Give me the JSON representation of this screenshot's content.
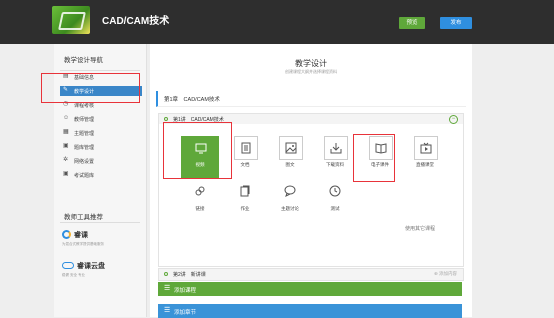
{
  "header": {
    "app_title": "CAD/CAM技术",
    "preview_label": "预览",
    "publish_label": "发布"
  },
  "sidebar": {
    "title": "教学设计导航",
    "items": [
      {
        "label": "基础信息",
        "icon": "document-icon"
      },
      {
        "label": "教学设计",
        "icon": "edit-icon",
        "active": true
      },
      {
        "label": "课程考核",
        "icon": "clock-icon"
      },
      {
        "label": "教师管理",
        "icon": "user-icon"
      },
      {
        "label": "主题管理",
        "icon": "grid-icon"
      },
      {
        "label": "题库管理",
        "icon": "box-icon"
      },
      {
        "label": "网络设置",
        "icon": "gear-icon"
      },
      {
        "label": "考试题库",
        "icon": "box-icon"
      }
    ],
    "tools_title": "教师工具推荐",
    "tools": [
      {
        "name": "睿课",
        "desc": "为混合式教学提供基础服务"
      },
      {
        "name": "睿课云盘",
        "desc": "稳健 安全 专业"
      }
    ]
  },
  "main": {
    "title": "教学设计",
    "subtitle": "创建课程大纲并选择课程资料",
    "chapter": "第1章　CAD/CAM技术",
    "lesson1": "第1讲　CAD/CAM技术",
    "resource_types": [
      {
        "label": "视频",
        "icon": "monitor-icon",
        "selected": true
      },
      {
        "label": "文档",
        "icon": "doc-icon"
      },
      {
        "label": "图文",
        "icon": "image-icon"
      },
      {
        "label": "下载资料",
        "icon": "download-icon"
      },
      {
        "label": "电子课件",
        "icon": "book-icon"
      },
      {
        "label": "直播课堂",
        "icon": "tv-icon"
      },
      {
        "label": "链接",
        "icon": "link-icon"
      },
      {
        "label": "作业",
        "icon": "homework-icon"
      },
      {
        "label": "主题讨论",
        "icon": "chat-icon"
      },
      {
        "label": "测试",
        "icon": "clock-icon"
      }
    ],
    "more_label": "使用其它课程",
    "lesson2": "第2讲　新讲课",
    "lesson2_action": "⊕ 添加内容",
    "add_lesson_label": "添加课程",
    "add_section_label": "添加章节"
  },
  "colors": {
    "accent_green": "#5fa83a",
    "accent_blue": "#2f8fe0",
    "highlight_red": "#e8333a",
    "topbar": "#2e2e2e"
  }
}
